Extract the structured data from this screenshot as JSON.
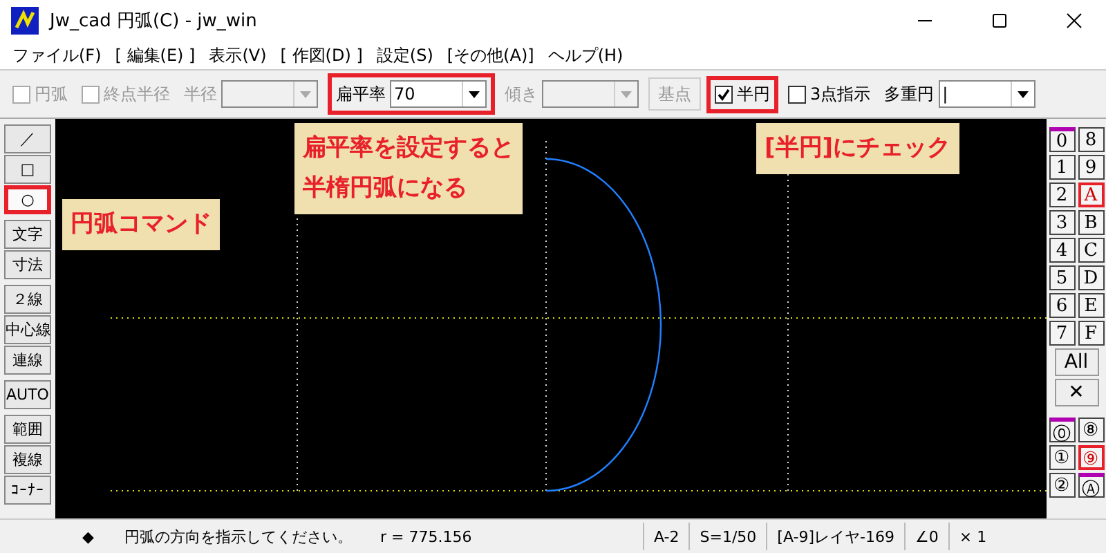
{
  "window": {
    "title": "Jw_cad 円弧(C) - jw_win"
  },
  "menu": [
    "ファイル(F)",
    "[ 編集(E) ]",
    "表示(V)",
    "[ 作図(D) ]",
    "設定(S)",
    "[その他(A)]",
    "ヘルプ(H)"
  ],
  "toolbar": [
    {
      "kind": "checkbox",
      "label": "円弧",
      "checked": false,
      "disabled": true
    },
    {
      "kind": "checkbox",
      "label": "終点半径",
      "checked": false,
      "disabled": true
    },
    {
      "kind": "combo",
      "label": "半径",
      "disabled": true
    },
    {
      "kind": "highlight",
      "items": [
        {
          "kind": "combo",
          "label": "扁平率",
          "value": "70",
          "disabled": false
        }
      ]
    },
    {
      "kind": "combo",
      "label": "傾き",
      "disabled": true
    },
    {
      "kind": "button",
      "label": "基点",
      "disabled": true
    },
    {
      "kind": "highlight",
      "items": [
        {
          "kind": "checkbox",
          "label": "半円",
          "checked": true,
          "disabled": false
        }
      ]
    },
    {
      "kind": "checkbox",
      "label": "3点指示",
      "checked": false,
      "disabled": false
    },
    {
      "kind": "combo",
      "label": "多重円",
      "value": "|",
      "disabled": false
    }
  ],
  "tool_groups": [
    [
      {
        "label": "／",
        "selected": false
      },
      {
        "label": "□",
        "selected": false
      },
      {
        "label": "○",
        "selected": true
      }
    ],
    [
      {
        "label": "文字",
        "selected": false
      },
      {
        "label": "寸法",
        "selected": false
      }
    ],
    [
      {
        "label": "２線",
        "selected": false
      },
      {
        "label": "中心線",
        "selected": false
      },
      {
        "label": "連線",
        "selected": false
      }
    ],
    [
      {
        "label": "AUTO",
        "selected": false
      }
    ],
    [
      {
        "label": "範囲",
        "selected": false
      },
      {
        "label": "複線",
        "selected": false
      },
      {
        "label": "ｺｰﾅｰ",
        "selected": false
      }
    ]
  ],
  "layers": [
    {
      "label": "0",
      "selected": false,
      "marked": true
    },
    {
      "label": "8",
      "selected": false,
      "marked": false
    },
    {
      "label": "1",
      "selected": false,
      "marked": false
    },
    {
      "label": "9",
      "selected": false,
      "marked": false
    },
    {
      "label": "2",
      "selected": false,
      "marked": false
    },
    {
      "label": "A",
      "selected": true,
      "marked": false
    },
    {
      "label": "3",
      "selected": false,
      "marked": false
    },
    {
      "label": "B",
      "selected": false,
      "marked": false
    },
    {
      "label": "4",
      "selected": false,
      "marked": false
    },
    {
      "label": "C",
      "selected": false,
      "marked": false
    },
    {
      "label": "5",
      "selected": false,
      "marked": false
    },
    {
      "label": "D",
      "selected": false,
      "marked": false
    },
    {
      "label": "6",
      "selected": false,
      "marked": false
    },
    {
      "label": "E",
      "selected": false,
      "marked": false
    },
    {
      "label": "7",
      "selected": false,
      "marked": false
    },
    {
      "label": "F",
      "selected": false,
      "marked": false
    }
  ],
  "layer_buttons": [
    "All",
    "✕"
  ],
  "groups": [
    {
      "label": "⓪",
      "selected": false,
      "marked": true
    },
    {
      "label": "⑧",
      "selected": false,
      "marked": false
    },
    {
      "label": "①",
      "selected": false,
      "marked": false
    },
    {
      "label": "⑨",
      "selected": true,
      "marked": false
    },
    {
      "label": "②",
      "selected": false,
      "marked": false
    },
    {
      "label": "Ⓐ",
      "selected": false,
      "marked": true
    }
  ],
  "callouts": [
    {
      "lines": [
        "扁平率を設定すると",
        "半楕円弧になる"
      ]
    },
    {
      "lines": [
        "[半円]にチェック"
      ]
    },
    {
      "lines": [
        "円弧コマンド"
      ]
    }
  ],
  "status_bar": {
    "marker": "◆",
    "message": "円弧の方向を指示してください。",
    "reading": "r = 775.156",
    "cells": [
      "A-2",
      "S=1/50",
      "[A-9]レイヤ-169",
      "∠0",
      "× 1"
    ]
  }
}
